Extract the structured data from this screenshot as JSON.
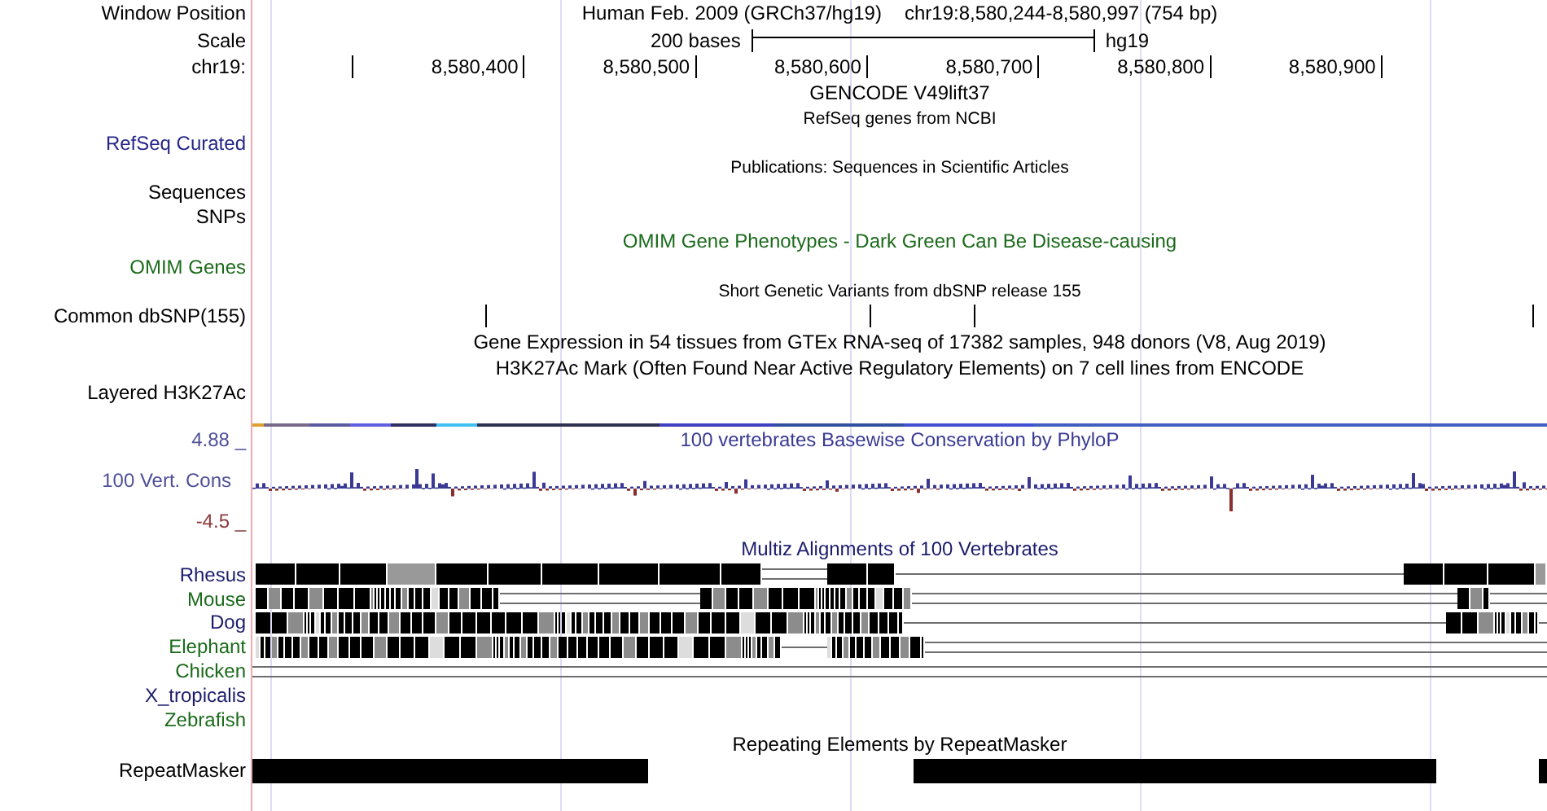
{
  "header": {
    "position_label": "Window Position",
    "assembly": "Human Feb. 2009 (GRCh37/hg19)",
    "position": "chr19:8,580,244-8,580,997 (754 bp)",
    "scale_label": "Scale",
    "scale_text": "200 bases",
    "scale_db": "hg19",
    "chrom_label": "chr19:",
    "ticks": [
      "8,580,400",
      "8,580,500",
      "8,580,600",
      "8,580,700",
      "8,580,800",
      "8,580,900"
    ]
  },
  "rows": [
    {
      "kind": "title",
      "title": "GENCODE V49lift37"
    },
    {
      "kind": "subtitle",
      "title": "RefSeq genes from NCBI"
    },
    {
      "kind": "label",
      "label": "RefSeq Curated",
      "color": "#262688"
    },
    {
      "kind": "subtitle",
      "title": "Publications: Sequences in Scientific Articles"
    },
    {
      "kind": "label",
      "label": "Sequences",
      "color": "#000000"
    },
    {
      "kind": "label",
      "label": "SNPs",
      "color": "#000000"
    },
    {
      "kind": "title",
      "title": "OMIM Gene Phenotypes - Dark Green Can Be Disease-causing",
      "color": "#1b6b1b"
    },
    {
      "kind": "label",
      "label": "OMIM Genes",
      "color": "#1b6b1b"
    },
    {
      "kind": "subtitle",
      "title": "Short Genetic Variants from dbSNP release 155"
    },
    {
      "kind": "snps",
      "label": "Common dbSNP(155)"
    },
    {
      "kind": "title",
      "title": "Gene Expression in 54 tissues from GTEx RNA-seq of 17382 samples, 948 donors (V8, Aug 2019)"
    },
    {
      "kind": "title",
      "title": "H3K27Ac Mark (Often Found Near Active Regulatory Elements) on 7 cell lines from ENCODE"
    },
    {
      "kind": "layered",
      "label": "Layered H3K27Ac"
    },
    {
      "kind": "wiggle",
      "title": "100 vertebrates Basewise Conservation by PhyloP",
      "label": "100 Vert. Cons",
      "max": "4.88 _",
      "min": "-4.5 _"
    },
    {
      "kind": "title",
      "title": "Multiz Alignments of 100 Vertebrates",
      "color": "#1c1c6c"
    },
    {
      "kind": "species",
      "label": "Rhesus",
      "color": "#1c1c6c"
    },
    {
      "kind": "species",
      "label": "Mouse",
      "color": "#1b6b1b"
    },
    {
      "kind": "species",
      "label": "Dog",
      "color": "#1c1c6c"
    },
    {
      "kind": "species",
      "label": "Elephant",
      "color": "#1b6b1b"
    },
    {
      "kind": "species",
      "label": "Chicken",
      "color": "#1b6b1b"
    },
    {
      "kind": "species",
      "label": "X_tropicalis",
      "color": "#1c1c6c"
    },
    {
      "kind": "species",
      "label": "Zebrafish",
      "color": "#1b6b1b"
    },
    {
      "kind": "title",
      "title": "Repeating Elements by RepeatMasker"
    },
    {
      "kind": "bars",
      "label": "RepeatMasker"
    }
  ]
}
